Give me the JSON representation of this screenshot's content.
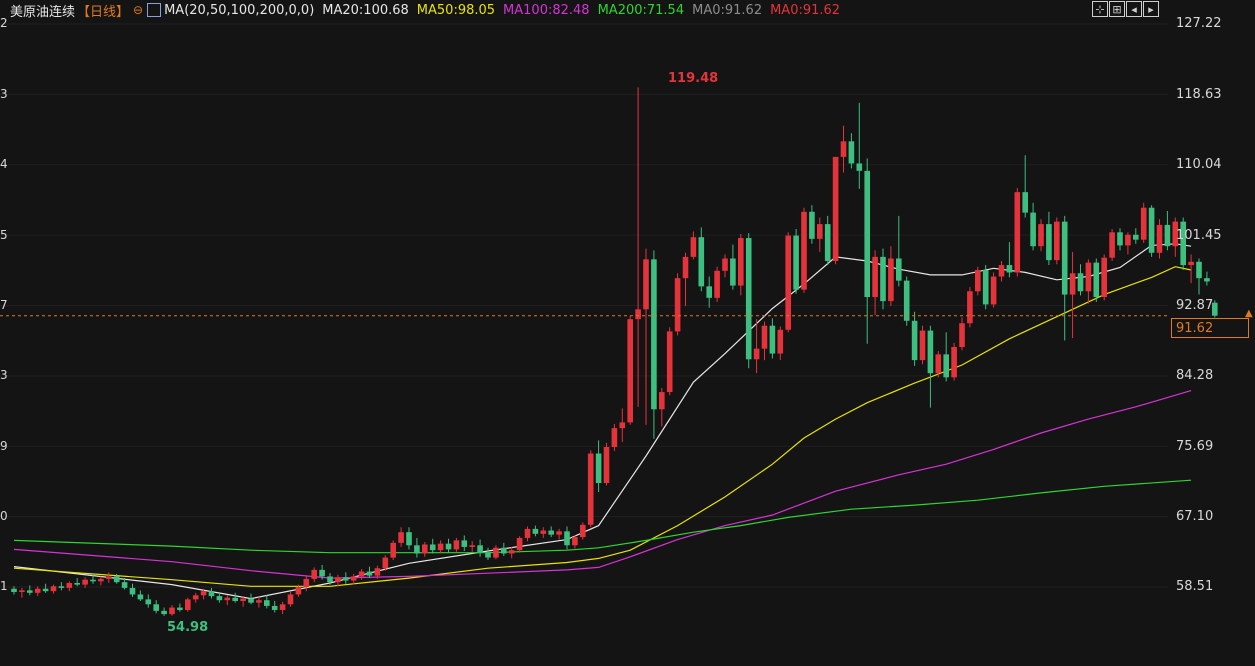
{
  "header": {
    "symbol": "美原油连续",
    "period": "【日线】",
    "circle_icon": "circle-minus-icon",
    "ma_icon": "indicator-chart-icon",
    "ma_params": "MA(20,50,100,200,0,0)",
    "ma_values": [
      {
        "text": "MA20:100.68",
        "color": "#e6e6e6"
      },
      {
        "text": "MA50:98.05",
        "color": "#e8e300"
      },
      {
        "text": "MA100:82.48",
        "color": "#d633d6"
      },
      {
        "text": "MA200:71.54",
        "color": "#2fd52f"
      },
      {
        "text": "MA0:91.62",
        "color": "#8c8c8c"
      },
      {
        "text": "MA0:91.62",
        "color": "#e5333b"
      }
    ]
  },
  "toolbar": {
    "buttons": [
      {
        "icon": "crosshair-icon",
        "glyph": "⊹"
      },
      {
        "icon": "panel-icon",
        "glyph": "⊞"
      },
      {
        "icon": "prev-icon",
        "glyph": "◂"
      },
      {
        "icon": "next-icon",
        "glyph": "▸"
      }
    ]
  },
  "y_axis_labels": [
    "127.22",
    "118.63",
    "110.04",
    "101.45",
    "92.87",
    "84.28",
    "75.69",
    "67.10",
    "58.51"
  ],
  "left_axis_labels": [
    "2",
    "3",
    "4",
    "5",
    "7",
    "3",
    "9",
    "0",
    "1"
  ],
  "current_price": "91.62",
  "annotations": {
    "high": "119.48",
    "low": "54.98"
  },
  "colors": {
    "up": "#e5333b",
    "down": "#3dbf7f",
    "bg": "#141414",
    "accent": "#e07a1e"
  },
  "chart_data": {
    "type": "candlestick",
    "y_axis": {
      "ticks": [
        127.22,
        118.63,
        110.04,
        101.45,
        92.87,
        84.28,
        75.69,
        67.1,
        58.51
      ],
      "range": [
        53.8,
        127.22
      ]
    },
    "current_price": 91.62,
    "high": 119.48,
    "low": 54.98,
    "ohlc": [
      [
        58.3,
        58.6,
        57.6,
        57.9
      ],
      [
        57.9,
        58.4,
        57.2,
        58.1
      ],
      [
        58.1,
        58.7,
        57.5,
        57.8
      ],
      [
        57.8,
        58.6,
        57.4,
        58.3
      ],
      [
        58.3,
        58.9,
        57.8,
        58.0
      ],
      [
        58.0,
        58.8,
        57.7,
        58.6
      ],
      [
        58.6,
        59.1,
        58.1,
        58.4
      ],
      [
        58.4,
        59.2,
        58.0,
        59.0
      ],
      [
        59.0,
        59.6,
        58.6,
        58.8
      ],
      [
        58.8,
        59.7,
        58.4,
        59.4
      ],
      [
        59.4,
        60.1,
        58.9,
        59.2
      ],
      [
        59.2,
        59.8,
        58.7,
        59.5
      ],
      [
        59.5,
        60.3,
        59.0,
        59.8
      ],
      [
        59.8,
        60.1,
        58.9,
        59.1
      ],
      [
        59.1,
        59.6,
        58.2,
        58.4
      ],
      [
        58.4,
        58.9,
        57.3,
        57.6
      ],
      [
        57.6,
        58.1,
        56.8,
        57.0
      ],
      [
        57.0,
        57.6,
        56.0,
        56.4
      ],
      [
        56.4,
        56.9,
        55.3,
        55.6
      ],
      [
        55.6,
        56.0,
        54.98,
        55.2
      ],
      [
        55.2,
        56.3,
        55.0,
        56.0
      ],
      [
        56.0,
        56.5,
        55.5,
        55.7
      ],
      [
        55.7,
        57.2,
        55.5,
        57.0
      ],
      [
        57.0,
        57.8,
        56.6,
        57.5
      ],
      [
        57.5,
        58.3,
        57.0,
        58.0
      ],
      [
        58.0,
        58.4,
        57.1,
        57.4
      ],
      [
        57.4,
        57.9,
        56.6,
        56.9
      ],
      [
        56.9,
        57.5,
        56.3,
        57.2
      ],
      [
        57.2,
        57.8,
        56.6,
        56.8
      ],
      [
        56.8,
        57.4,
        56.1,
        57.1
      ],
      [
        57.1,
        57.7,
        56.4,
        56.6
      ],
      [
        56.6,
        57.3,
        56.0,
        56.9
      ],
      [
        56.9,
        57.5,
        55.9,
        56.2
      ],
      [
        56.2,
        56.8,
        55.4,
        55.7
      ],
      [
        55.7,
        56.7,
        55.2,
        56.4
      ],
      [
        56.4,
        57.9,
        56.1,
        57.6
      ],
      [
        57.6,
        58.8,
        57.3,
        58.5
      ],
      [
        58.5,
        59.8,
        58.0,
        59.5
      ],
      [
        59.5,
        60.9,
        59.1,
        60.6
      ],
      [
        60.6,
        61.2,
        59.4,
        59.8
      ],
      [
        59.8,
        60.2,
        58.8,
        59.1
      ],
      [
        59.1,
        60.0,
        58.6,
        59.7
      ],
      [
        59.7,
        60.3,
        58.9,
        59.3
      ],
      [
        59.3,
        60.1,
        58.8,
        59.8
      ],
      [
        59.8,
        60.7,
        59.4,
        60.4
      ],
      [
        60.4,
        61.0,
        59.6,
        59.9
      ],
      [
        59.9,
        61.1,
        59.5,
        60.8
      ],
      [
        60.8,
        62.4,
        60.5,
        62.1
      ],
      [
        62.1,
        64.2,
        61.8,
        63.9
      ],
      [
        63.9,
        65.8,
        63.4,
        65.2
      ],
      [
        65.2,
        65.8,
        63.1,
        63.6
      ],
      [
        63.6,
        64.5,
        62.1,
        62.6
      ],
      [
        62.6,
        64.0,
        62.2,
        63.7
      ],
      [
        63.7,
        64.4,
        62.6,
        63.0
      ],
      [
        63.0,
        64.2,
        62.6,
        63.8
      ],
      [
        63.8,
        64.4,
        62.7,
        63.1
      ],
      [
        63.1,
        64.5,
        62.8,
        64.2
      ],
      [
        64.2,
        64.8,
        62.9,
        63.4
      ],
      [
        63.4,
        64.1,
        62.8,
        63.6
      ],
      [
        63.6,
        64.3,
        62.2,
        62.7
      ],
      [
        62.7,
        63.3,
        61.8,
        62.1
      ],
      [
        62.1,
        63.6,
        61.9,
        63.3
      ],
      [
        63.3,
        63.9,
        62.3,
        62.6
      ],
      [
        62.6,
        63.4,
        62.0,
        63.0
      ],
      [
        63.0,
        64.7,
        62.7,
        64.5
      ],
      [
        64.5,
        65.9,
        64.1,
        65.6
      ],
      [
        65.6,
        66.0,
        64.7,
        65.0
      ],
      [
        65.0,
        65.8,
        64.5,
        65.4
      ],
      [
        65.4,
        65.9,
        64.6,
        64.9
      ],
      [
        64.9,
        65.6,
        64.3,
        65.3
      ],
      [
        65.3,
        65.9,
        63.1,
        63.6
      ],
      [
        63.6,
        64.8,
        63.2,
        64.6
      ],
      [
        64.6,
        66.4,
        64.3,
        66.1
      ],
      [
        66.1,
        75.2,
        65.8,
        74.8
      ],
      [
        74.8,
        76.4,
        70.1,
        71.2
      ],
      [
        71.2,
        76.1,
        70.9,
        75.6
      ],
      [
        75.6,
        78.4,
        75.1,
        77.9
      ],
      [
        77.9,
        80.3,
        76.2,
        78.6
      ],
      [
        78.6,
        91.6,
        78.3,
        91.2
      ],
      [
        91.2,
        119.48,
        80.5,
        92.4
      ],
      [
        92.4,
        99.8,
        78.3,
        98.5
      ],
      [
        98.5,
        99.6,
        76.6,
        80.2
      ],
      [
        80.2,
        82.8,
        78.1,
        82.3
      ],
      [
        82.3,
        90.2,
        81.9,
        89.7
      ],
      [
        89.7,
        96.8,
        89.2,
        96.2
      ],
      [
        96.2,
        99.3,
        92.8,
        98.8
      ],
      [
        98.8,
        101.9,
        98.5,
        101.2
      ],
      [
        101.2,
        102.4,
        94.6,
        95.2
      ],
      [
        95.2,
        96.4,
        92.6,
        93.8
      ],
      [
        93.8,
        97.6,
        93.3,
        97.1
      ],
      [
        97.1,
        99.1,
        96.3,
        98.6
      ],
      [
        98.6,
        100.3,
        94.8,
        95.3
      ],
      [
        95.3,
        101.6,
        94.1,
        101.1
      ],
      [
        101.1,
        101.7,
        85.2,
        86.3
      ],
      [
        86.3,
        91.2,
        84.6,
        87.6
      ],
      [
        87.6,
        90.9,
        86.2,
        90.4
      ],
      [
        90.4,
        91.3,
        86.4,
        87.0
      ],
      [
        87.0,
        90.3,
        86.2,
        89.9
      ],
      [
        89.9,
        101.8,
        89.6,
        101.4
      ],
      [
        101.4,
        102.2,
        94.3,
        94.8
      ],
      [
        94.8,
        104.8,
        94.4,
        104.3
      ],
      [
        104.3,
        105.1,
        100.4,
        101.0
      ],
      [
        101.0,
        103.6,
        99.4,
        102.8
      ],
      [
        102.8,
        103.8,
        97.8,
        98.3
      ],
      [
        98.3,
        110.1,
        97.9,
        111.0
      ],
      [
        111.0,
        114.8,
        109.1,
        112.9
      ],
      [
        112.9,
        113.9,
        109.6,
        110.2
      ],
      [
        110.2,
        117.6,
        107.1,
        109.3
      ],
      [
        109.3,
        110.8,
        88.2,
        93.9
      ],
      [
        93.9,
        99.6,
        91.7,
        98.8
      ],
      [
        98.8,
        99.8,
        92.4,
        93.4
      ],
      [
        93.4,
        100.1,
        92.8,
        98.6
      ],
      [
        98.6,
        103.8,
        95.2,
        95.9
      ],
      [
        95.9,
        96.4,
        90.4,
        91.0
      ],
      [
        91.0,
        92.1,
        85.5,
        86.2
      ],
      [
        86.2,
        90.4,
        85.7,
        89.8
      ],
      [
        89.8,
        90.4,
        80.4,
        84.6
      ],
      [
        84.6,
        87.3,
        84.1,
        86.9
      ],
      [
        86.9,
        89.6,
        83.6,
        84.1
      ],
      [
        84.1,
        88.3,
        83.7,
        87.8
      ],
      [
        87.8,
        91.4,
        87.4,
        90.7
      ],
      [
        90.7,
        95.1,
        90.2,
        94.6
      ],
      [
        94.6,
        97.6,
        94.1,
        97.2
      ],
      [
        97.2,
        97.8,
        92.4,
        93.0
      ],
      [
        93.0,
        96.9,
        92.6,
        96.4
      ],
      [
        96.4,
        98.3,
        95.8,
        97.8
      ],
      [
        97.8,
        100.6,
        96.3,
        96.9
      ],
      [
        96.9,
        107.2,
        96.4,
        106.7
      ],
      [
        106.7,
        111.2,
        103.6,
        104.2
      ],
      [
        104.2,
        105.4,
        99.6,
        100.1
      ],
      [
        100.1,
        103.4,
        99.5,
        102.8
      ],
      [
        102.8,
        104.3,
        97.8,
        98.4
      ],
      [
        98.4,
        103.6,
        97.9,
        103.1
      ],
      [
        103.1,
        103.8,
        88.6,
        94.2
      ],
      [
        94.2,
        99.4,
        88.9,
        96.8
      ],
      [
        96.8,
        97.9,
        94.1,
        94.6
      ],
      [
        94.6,
        98.5,
        93.1,
        98.1
      ],
      [
        98.1,
        98.6,
        93.3,
        93.9
      ],
      [
        93.9,
        99.1,
        93.5,
        98.7
      ],
      [
        98.7,
        102.2,
        98.3,
        101.8
      ],
      [
        101.8,
        102.3,
        99.6,
        100.2
      ],
      [
        100.2,
        101.8,
        99.1,
        101.5
      ],
      [
        101.5,
        102.3,
        100.4,
        100.9
      ],
      [
        100.9,
        105.4,
        100.5,
        104.8
      ],
      [
        104.8,
        105.1,
        98.8,
        99.3
      ],
      [
        99.3,
        103.4,
        98.6,
        102.7
      ],
      [
        102.7,
        104.4,
        99.6,
        100.1
      ],
      [
        100.1,
        103.6,
        98.8,
        103.1
      ],
      [
        103.1,
        103.6,
        97.2,
        97.8
      ],
      [
        97.8,
        99.1,
        95.6,
        98.2
      ],
      [
        98.2,
        98.6,
        94.2,
        96.2
      ],
      [
        96.2,
        97.0,
        95.3,
        95.8
      ],
      [
        93.2,
        93.5,
        91.4,
        91.62
      ]
    ],
    "ma_series": [
      {
        "name": "MA20",
        "color": "#e6e6e6",
        "points": [
          [
            0,
            61.0
          ],
          [
            20,
            58.8
          ],
          [
            30,
            57.1
          ],
          [
            40,
            59.0
          ],
          [
            50,
            61.4
          ],
          [
            60,
            62.9
          ],
          [
            70,
            64.3
          ],
          [
            74,
            66.0
          ],
          [
            80,
            74.5
          ],
          [
            86,
            83.5
          ],
          [
            90,
            87.0
          ],
          [
            96,
            92.5
          ],
          [
            100,
            95.5
          ],
          [
            104,
            98.8
          ],
          [
            108,
            98.3
          ],
          [
            112,
            97.3
          ],
          [
            116,
            96.6
          ],
          [
            120,
            96.6
          ],
          [
            124,
            97.4
          ],
          [
            128,
            96.9
          ],
          [
            132,
            96.0
          ],
          [
            136,
            96.4
          ],
          [
            140,
            97.5
          ],
          [
            144,
            100.2
          ],
          [
            147,
            100.4
          ],
          [
            149,
            100.1
          ]
        ]
      },
      {
        "name": "MA50",
        "color": "#e8e300",
        "points": [
          [
            0,
            60.8
          ],
          [
            20,
            59.4
          ],
          [
            30,
            58.6
          ],
          [
            40,
            58.6
          ],
          [
            50,
            59.6
          ],
          [
            60,
            60.8
          ],
          [
            70,
            61.5
          ],
          [
            74,
            62.0
          ],
          [
            78,
            63.0
          ],
          [
            84,
            66.0
          ],
          [
            90,
            69.5
          ],
          [
            96,
            73.5
          ],
          [
            100,
            76.7
          ],
          [
            104,
            79.0
          ],
          [
            108,
            81.0
          ],
          [
            114,
            83.4
          ],
          [
            120,
            85.6
          ],
          [
            126,
            88.8
          ],
          [
            132,
            91.5
          ],
          [
            138,
            94.2
          ],
          [
            144,
            96.3
          ],
          [
            147,
            97.6
          ],
          [
            149,
            97.2
          ]
        ]
      },
      {
        "name": "MA100",
        "color": "#d633d6",
        "points": [
          [
            0,
            63.1
          ],
          [
            20,
            61.6
          ],
          [
            30,
            60.5
          ],
          [
            40,
            59.6
          ],
          [
            50,
            59.8
          ],
          [
            60,
            60.2
          ],
          [
            70,
            60.6
          ],
          [
            74,
            60.9
          ],
          [
            78,
            62.2
          ],
          [
            84,
            64.3
          ],
          [
            90,
            66.0
          ],
          [
            96,
            67.3
          ],
          [
            104,
            70.2
          ],
          [
            112,
            72.2
          ],
          [
            118,
            73.5
          ],
          [
            124,
            75.3
          ],
          [
            130,
            77.3
          ],
          [
            136,
            79.0
          ],
          [
            142,
            80.5
          ],
          [
            149,
            82.48
          ]
        ]
      },
      {
        "name": "MA200",
        "color": "#2fd52f",
        "points": [
          [
            0,
            64.2
          ],
          [
            20,
            63.5
          ],
          [
            30,
            63.0
          ],
          [
            40,
            62.7
          ],
          [
            50,
            62.7
          ],
          [
            60,
            62.7
          ],
          [
            70,
            63.0
          ],
          [
            74,
            63.3
          ],
          [
            80,
            64.2
          ],
          [
            86,
            65.2
          ],
          [
            92,
            66.0
          ],
          [
            98,
            67.0
          ],
          [
            106,
            68.0
          ],
          [
            114,
            68.5
          ],
          [
            122,
            69.1
          ],
          [
            130,
            70.0
          ],
          [
            138,
            70.8
          ],
          [
            149,
            71.54
          ]
        ]
      }
    ]
  }
}
